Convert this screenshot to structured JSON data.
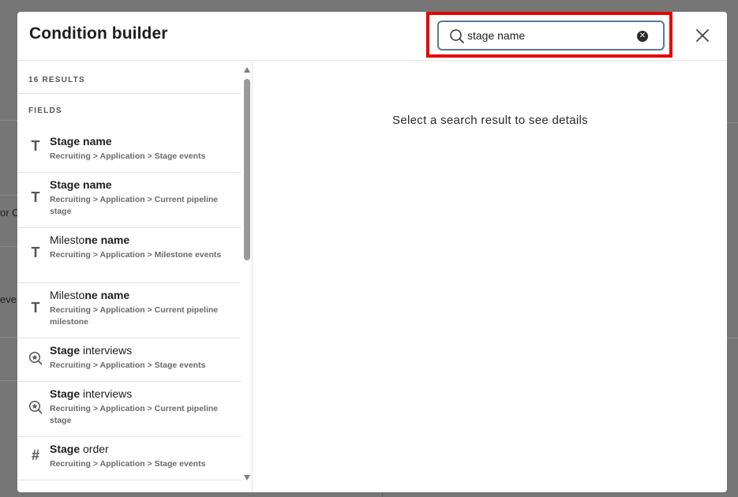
{
  "background": {
    "fragments": [
      "or O",
      "eve"
    ]
  },
  "modal": {
    "title": "Condition builder"
  },
  "search": {
    "value": "stage name",
    "placeholder": ""
  },
  "results": {
    "count_label": "16 RESULTS",
    "section_label": "FIELDS",
    "items": [
      {
        "icon": "text-type-icon",
        "title_bold": "Stage name",
        "title_rest": "",
        "path": "Recruiting > Application > Stage events"
      },
      {
        "icon": "text-type-icon",
        "title_bold": "Stage name",
        "title_rest": "",
        "path": "Recruiting > Application > Current pipeline stage"
      },
      {
        "icon": "text-type-icon",
        "title_plain": "Milesto",
        "title_bold": "ne name",
        "path": "Recruiting > Application > Milestone events"
      },
      {
        "icon": "text-type-icon",
        "title_plain": "Milesto",
        "title_bold": "ne name",
        "path": "Recruiting > Application > Current pipeline milestone"
      },
      {
        "icon": "interview-star-icon",
        "title_bold": "Stage",
        "title_rest": " interviews",
        "path": "Recruiting > Application > Stage events"
      },
      {
        "icon": "interview-star-icon",
        "title_bold": "Stage",
        "title_rest": " interviews",
        "path": "Recruiting > Application > Current pipeline stage"
      },
      {
        "icon": "number-hash-icon",
        "title_bold": "Stage",
        "title_rest": " order",
        "path": "Recruiting > Application > Stage events"
      }
    ]
  },
  "details": {
    "empty_message": "Select a search result to see details"
  },
  "icons": {
    "search": "search-icon",
    "clear": "clear-search-icon",
    "close": "close-icon"
  }
}
